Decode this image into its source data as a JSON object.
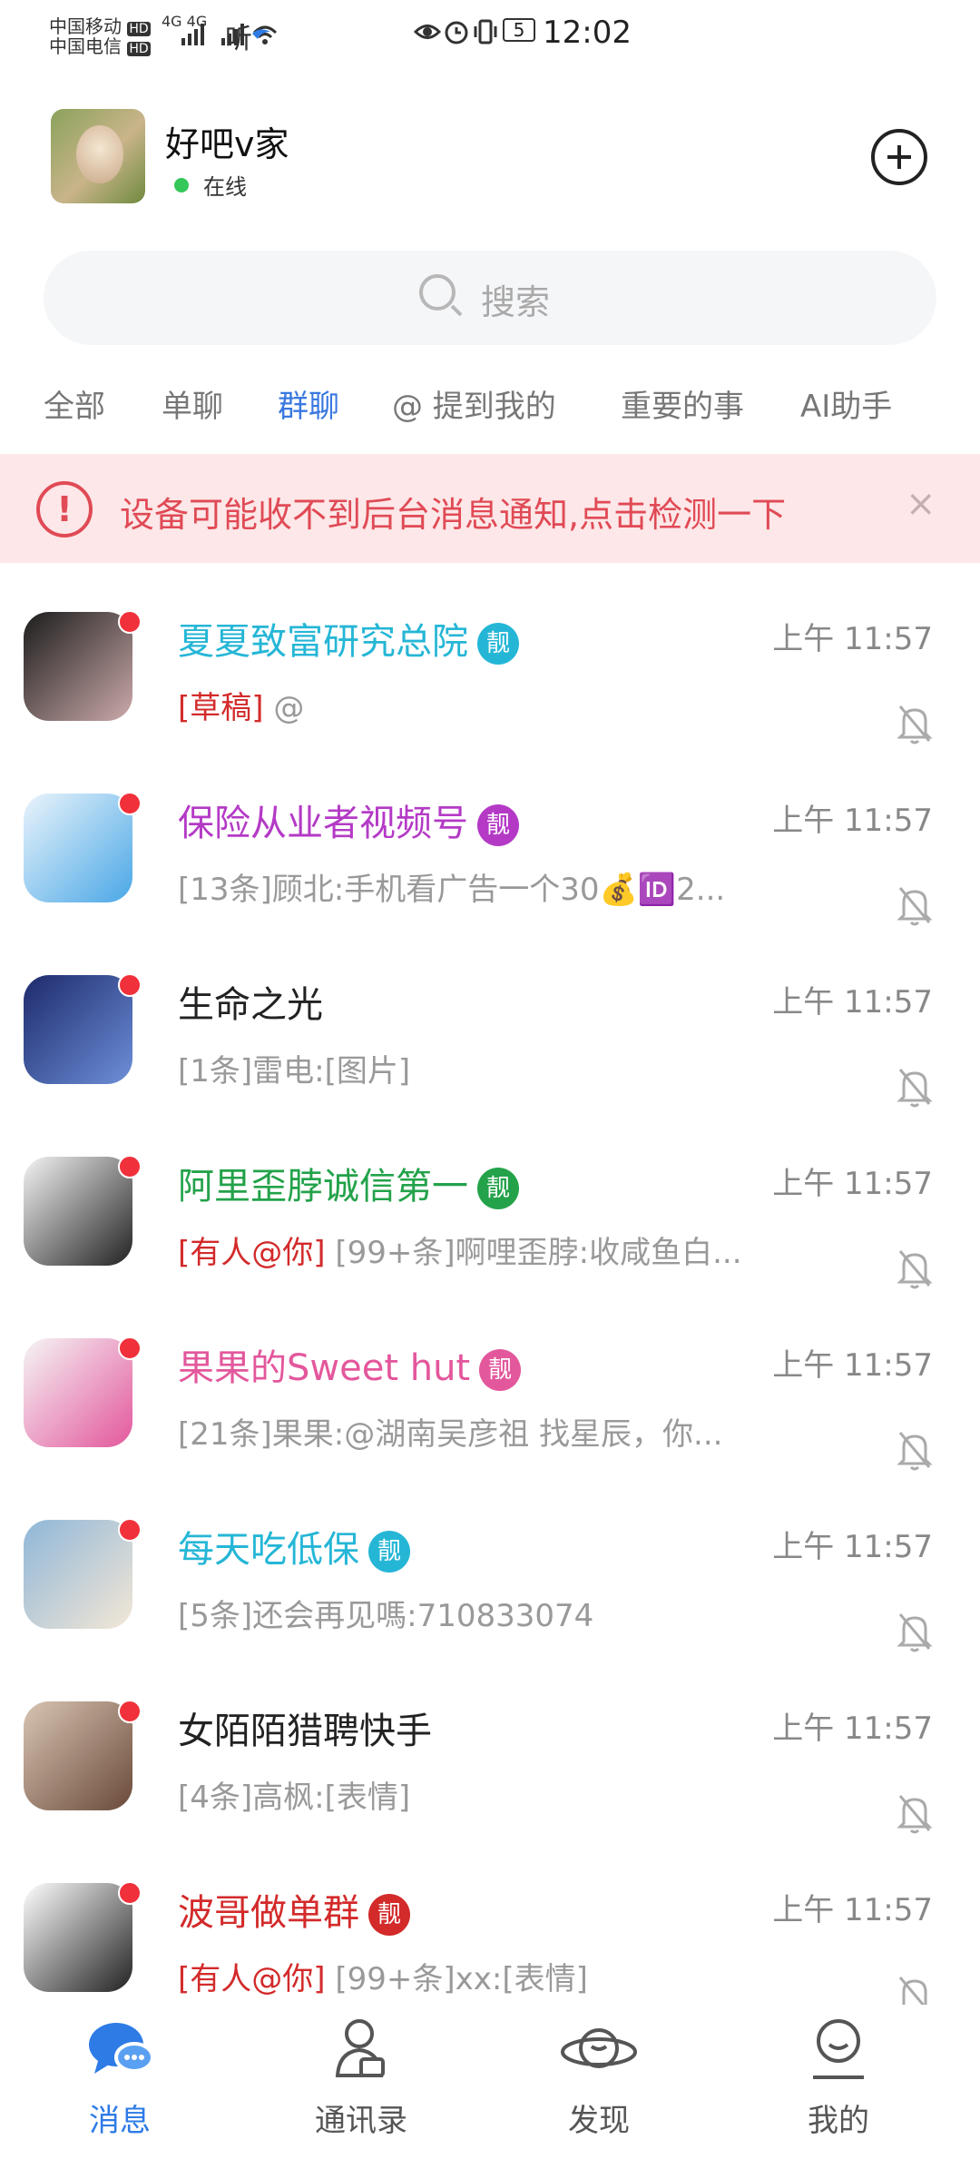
{
  "status_bar": {
    "carrier1": "中国移动",
    "carrier2": "中国电信",
    "hd1": "HD",
    "hd2": "HD",
    "signal_text": "4G 4G",
    "listen_text": "听",
    "battery": "5",
    "time": "12:02"
  },
  "header": {
    "title": "好吧v家",
    "status": "在线"
  },
  "search": {
    "placeholder": "搜索"
  },
  "tabs": [
    {
      "label": "全部"
    },
    {
      "label": "单聊"
    },
    {
      "label": "群聊"
    },
    {
      "label": "@ 提到我的"
    },
    {
      "label": "重要的事"
    },
    {
      "label": "AI助手"
    }
  ],
  "active_tab": "群聊",
  "banner": {
    "text": "设备可能收不到后台消息通知,点击检测一下",
    "icon": "warning-icon",
    "close": "×"
  },
  "badge_label": "靓",
  "chats": [
    {
      "name": "夏夏致富研究总院",
      "name_color": "#25b6d6",
      "badge": true,
      "badge_color": "#25b6d6",
      "time": "上午 11:57",
      "tag": "[草稿]",
      "message": " @",
      "avatar_colors": [
        "#1c1c1c",
        "#caa"
      ]
    },
    {
      "name": "保险从业者视频号",
      "name_color": "#b43ac6",
      "badge": true,
      "badge_color": "#b43ac6",
      "time": "上午 11:57",
      "tag": "",
      "message": "[13条]顾北:手机看广告一个30💰🆔2...",
      "avatar_colors": [
        "#eaf4fb",
        "#4aa7e6"
      ]
    },
    {
      "name": "生命之光",
      "name_color": "#222222",
      "badge": false,
      "badge_color": "",
      "time": "上午 11:57",
      "tag": "",
      "message": "[1条]雷电:[图片]",
      "avatar_colors": [
        "#1d2a6b",
        "#6d8fd8"
      ]
    },
    {
      "name": "阿里歪脖诚信第一",
      "name_color": "#23a24a",
      "badge": true,
      "badge_color": "#23a24a",
      "time": "上午 11:57",
      "tag": "[有人@你]",
      "message": " [99+条]啊哩歪脖:收咸鱼白...",
      "avatar_colors": [
        "#f4f4f4",
        "#222"
      ]
    },
    {
      "name": "果果的Sweet hut",
      "name_color": "#e3579c",
      "badge": true,
      "badge_color": "#e3579c",
      "time": "上午 11:57",
      "tag": "",
      "message": "[21条]果果:@湖南吴彦祖 找星辰，你...",
      "avatar_colors": [
        "#f5f5f5",
        "#e3579c"
      ]
    },
    {
      "name": "每天吃低保",
      "name_color": "#25b6d6",
      "badge": true,
      "badge_color": "#25b6d6",
      "time": "上午 11:57",
      "tag": "",
      "message": "[5条]还会再见嗎:710833074",
      "avatar_colors": [
        "#8fb7d8",
        "#f3e7d6"
      ]
    },
    {
      "name": "女陌陌猎聘快手",
      "name_color": "#222222",
      "badge": false,
      "badge_color": "",
      "time": "上午 11:57",
      "tag": "",
      "message": "[4条]高枫:[表情]",
      "avatar_colors": [
        "#d8c4b2",
        "#6a4a3a"
      ]
    },
    {
      "name": "波哥做单群",
      "name_color": "#d32a2a",
      "badge": true,
      "badge_color": "#d32a2a",
      "time": "上午 11:57",
      "tag": "[有人@你]",
      "message": " [99+条]xx:[表情]",
      "avatar_colors": [
        "#ffffff",
        "#222"
      ]
    }
  ],
  "nav": [
    {
      "label": "消息",
      "icon": "message-icon",
      "active": true
    },
    {
      "label": "通讯录",
      "icon": "contacts-icon",
      "active": false
    },
    {
      "label": "发现",
      "icon": "planet-icon",
      "active": false
    },
    {
      "label": "我的",
      "icon": "profile-icon",
      "active": false
    }
  ],
  "colors": {
    "accent": "#3a78e0",
    "warning": "#e04a55",
    "banner_bg": "#fde7e8",
    "unread_dot": "#f0303a",
    "online": "#34c759"
  }
}
